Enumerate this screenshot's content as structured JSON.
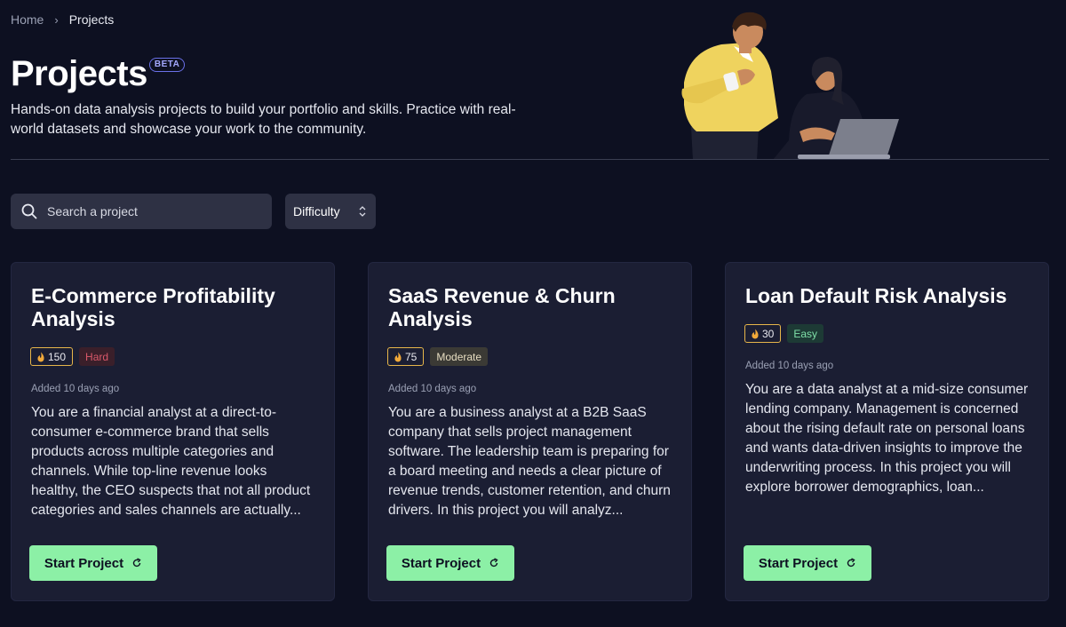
{
  "breadcrumb": {
    "home": "Home",
    "separator": "›",
    "current": "Projects"
  },
  "header": {
    "title": "Projects",
    "badge": "BETA",
    "subtitle": "Hands-on data analysis projects to build your portfolio and skills. Practice with real-world datasets and showcase your work to the community."
  },
  "search": {
    "placeholder": "Search a project",
    "value": ""
  },
  "filter": {
    "label": "Difficulty",
    "icon": "chevron-up-down-icon"
  },
  "colors": {
    "background": "#0d1021",
    "card": "#1b1e33",
    "accent_green": "#8cf0a6",
    "xp_border": "#e7b64a",
    "hard": "#d9586a",
    "easy": "#7fe0a8"
  },
  "cards": [
    {
      "title": "E-Commerce Profitability Analysis",
      "xp": "150",
      "difficulty": "Hard",
      "added": "Added 10 days ago",
      "description": "You are a financial analyst at a direct-to-consumer e-commerce brand that sells products across multiple categories and channels. While top-line revenue looks healthy, the CEO suspects that not all product categories and sales channels are actually...",
      "button": "Start Project"
    },
    {
      "title": "SaaS Revenue & Churn Analysis",
      "xp": "75",
      "difficulty": "Moderate",
      "added": "Added 10 days ago",
      "description": "You are a business analyst at a B2B SaaS company that sells project management software. The leadership team is preparing for a board meeting and needs a clear picture of revenue trends, customer retention, and churn drivers. In this project you will analyz...",
      "button": "Start Project"
    },
    {
      "title": "Loan Default Risk Analysis",
      "xp": "30",
      "difficulty": "Easy",
      "added": "Added 10 days ago",
      "description": "You are a data analyst at a mid-size consumer lending company. Management is concerned about the rising default rate on personal loans and wants data-driven insights to improve the underwriting process. In this project you will explore borrower demographics, loan...",
      "button": "Start Project"
    }
  ]
}
